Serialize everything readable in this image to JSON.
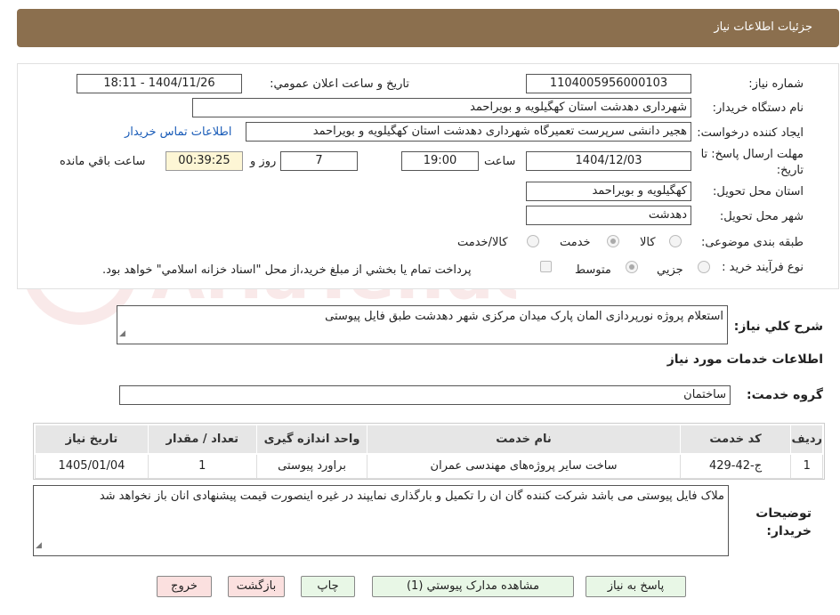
{
  "header": {
    "title": "جزئيات اطلاعات نياز"
  },
  "fields": {
    "need_number_label": "شماره نياز:",
    "need_number": "1104005956000103",
    "announce_label": "تاريخ و ساعت اعلان عمومي:",
    "announce_value": "1404/11/26 - 18:11",
    "buyer_org_label": "نام دستگاه خريدار:",
    "buyer_org": "شهرداری دهدشت استان کهگیلویه و بویراحمد",
    "requester_label": "ايجاد کننده درخواست:",
    "requester": "هجیر دانشی سرپرست تعمیرگاه شهرداری دهدشت استان کهگیلویه و بویراحمد",
    "buyer_contact_link": "اطلاعات تماس خريدار",
    "deadline_label": "مهلت ارسال پاسخ: تا تاريخ:",
    "deadline_date": "1404/12/03",
    "time_label": "ساعت",
    "deadline_time": "19:00",
    "days": "7",
    "days_label": "روز و",
    "remaining_time": "00:39:25",
    "remaining_label": "ساعت باقي مانده",
    "province_label": "استان محل تحويل:",
    "province": "کهگیلویه و بویراحمد",
    "city_label": "شهر محل تحويل:",
    "city": "دهدشت",
    "category_label": "طبقه بندی موضوعی:",
    "category_options": [
      "کالا",
      "خدمت",
      "کالا/خدمت"
    ],
    "category_selected": "خدمت",
    "process_label": "نوع فرآيند خريد :",
    "process_options": [
      "جزيي",
      "متوسط"
    ],
    "process_selected": "متوسط",
    "payment_note": "پرداخت تمام يا بخشي از مبلغ خريد،از محل \"اسناد خزانه اسلامي\" خواهد بود."
  },
  "description": {
    "label": "شرح کلي نياز:",
    "value": "استعلام پروژه نورپردازی المان پارک میدان مرکزی شهر دهدشت طبق فایل پیوستی"
  },
  "services_section": {
    "title": "اطلاعات خدمات مورد نياز",
    "group_label": "گروه خدمت:",
    "group_value": "ساختمان"
  },
  "table": {
    "headers": [
      "رديف",
      "کد خدمت",
      "نام خدمت",
      "واحد اندازه گيری",
      "تعداد / مقدار",
      "تاريخ نياز"
    ],
    "rows": [
      [
        "1",
        "ج-42-429",
        "ساخت سایر پروژه‌های مهندسی عمران",
        "براورد پیوستی",
        "1",
        "1405/01/04"
      ]
    ]
  },
  "buyer_notes": {
    "label": "توضيحات خريدار:",
    "value": "ملاک فایل پیوستی می باشد شرکت کننده گان ان را تکمیل و بارگذاری نمایپند در غیره اینصورت قیمت پیشنهادی انان باز نخواهد شد"
  },
  "buttons": {
    "reply": "پاسخ به نياز",
    "view_docs": "مشاهده مدارک پيوستي (1)",
    "print": "چاپ",
    "back": "بازگشت",
    "exit": "خروج"
  },
  "watermark": {
    "text": "AriaTender.neT"
  },
  "colors": {
    "header_bg": "#8b6f4e",
    "link": "#1a5cb8",
    "btn_green": "#e8f7e6",
    "btn_red": "#fbe0df",
    "remaining_bg": "#fdf6d5"
  }
}
